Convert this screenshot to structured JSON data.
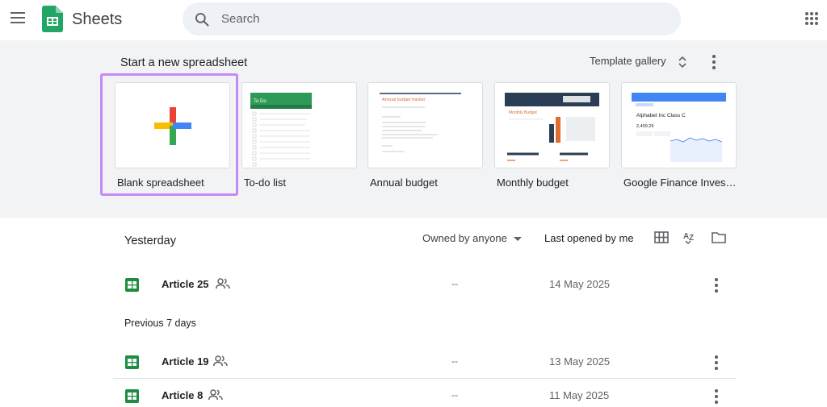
{
  "header": {
    "app_name": "Sheets",
    "search_placeholder": "Search"
  },
  "templates": {
    "title": "Start a new spreadsheet",
    "gallery_label": "Template gallery",
    "items": [
      {
        "label": "Blank spreadsheet"
      },
      {
        "label": "To-do list",
        "thumb_title": "To Do"
      },
      {
        "label": "Annual budget",
        "thumb_title": "Annual budget tracker"
      },
      {
        "label": "Monthly budget",
        "thumb_title": "Monthly Budget"
      },
      {
        "label": "Google Finance Investment Tracker",
        "thumb_title": "Alphabet Inc Class C",
        "thumb_value": "2,409.29"
      }
    ]
  },
  "recent": {
    "owner_filter": "Owned by anyone",
    "sort_label": "Last opened by me",
    "groups": [
      {
        "title": "Yesterday",
        "files": [
          {
            "name": "Article 25",
            "owner": "--",
            "date": "14 May 2025"
          }
        ]
      },
      {
        "title": "Previous 7 days",
        "files": [
          {
            "name": "Article 19",
            "owner": "--",
            "date": "13 May 2025"
          },
          {
            "name": "Article 8",
            "owner": "--",
            "date": "11 May 2025"
          }
        ]
      }
    ]
  },
  "colors": {
    "accent_green": "#0f9d58",
    "selection_purple": "#c58af9",
    "template_bg": "#f1f3f4"
  }
}
